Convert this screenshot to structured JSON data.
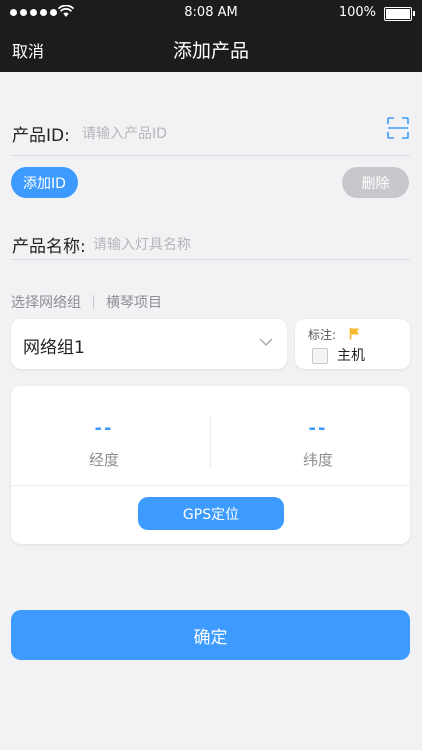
{
  "status_bar": {
    "time": "8:08 AM",
    "battery": "100%"
  },
  "nav": {
    "cancel": "取消",
    "title": "添加产品"
  },
  "product_id": {
    "label": "产品ID:",
    "placeholder": "请输入产品ID"
  },
  "buttons": {
    "add_id": "添加ID",
    "delete": "删除",
    "gps": "GPS定位",
    "confirm": "确定"
  },
  "product_name": {
    "label": "产品名称:",
    "placeholder": "请输入灯具名称"
  },
  "group": {
    "select_label": "选择网络组",
    "project": "横琴项目",
    "selected": "网络组1"
  },
  "mark": {
    "label": "标注:",
    "checkbox_label": "主机"
  },
  "coordinates": {
    "longitude_value": "--",
    "longitude_label": "经度",
    "latitude_value": "--",
    "latitude_label": "纬度"
  },
  "colors": {
    "accent": "#3d9bff",
    "header_bg": "#1c1c1c",
    "flag": "#f5b82e"
  }
}
